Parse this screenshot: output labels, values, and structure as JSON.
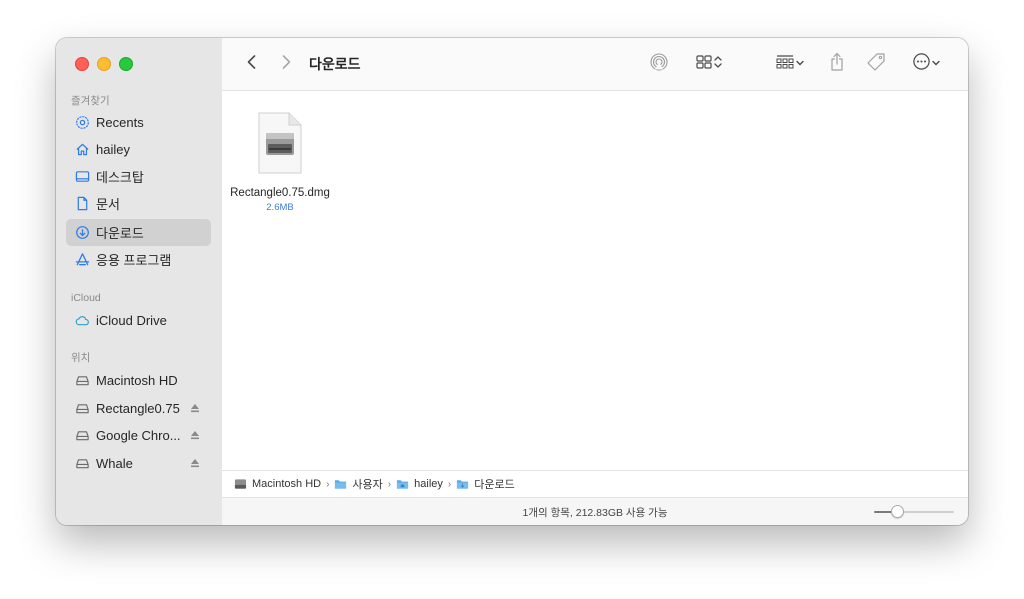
{
  "window": {
    "title": "다운로드"
  },
  "sidebar": {
    "favorites_label": "즐겨찾기",
    "favorites": [
      {
        "label": "Recents",
        "icon": "clock-gear-icon"
      },
      {
        "label": "hailey",
        "icon": "home-icon"
      },
      {
        "label": "데스크탑",
        "icon": "desktop-icon"
      },
      {
        "label": "문서",
        "icon": "document-icon"
      },
      {
        "label": "다운로드",
        "icon": "download-icon",
        "selected": true
      },
      {
        "label": "응용 프로그램",
        "icon": "applications-icon"
      }
    ],
    "icloud_label": "iCloud",
    "icloud": [
      {
        "label": "iCloud Drive",
        "icon": "cloud-icon"
      }
    ],
    "locations_label": "위치",
    "locations": [
      {
        "label": "Macintosh HD",
        "icon": "drive-icon",
        "eject": false
      },
      {
        "label": "Rectangle0.75",
        "icon": "drive-icon",
        "eject": true
      },
      {
        "label": "Google Chro...",
        "icon": "drive-icon",
        "eject": true
      },
      {
        "label": "Whale",
        "icon": "drive-icon",
        "eject": true
      }
    ]
  },
  "files": [
    {
      "name": "Rectangle0.75.dmg",
      "size": "2.6MB",
      "icon": "dmg-disk-image-icon"
    }
  ],
  "pathbar": [
    {
      "label": "Macintosh HD",
      "icon": "drive-icon"
    },
    {
      "label": "사용자",
      "icon": "folder-icon"
    },
    {
      "label": "hailey",
      "icon": "home-folder-icon"
    },
    {
      "label": "다운로드",
      "icon": "downloads-folder-icon"
    }
  ],
  "status": {
    "text": "1개의 항목, 212.83GB 사용 가능",
    "icon_size_fraction": 0.25
  },
  "colors": {
    "accent": "#1a73e8",
    "sidebar_bg": "#e6e6e6",
    "selected_bg": "#d1d1d1",
    "folder_blue": "#5aa9e6",
    "size_text": "#3b7fd6"
  }
}
